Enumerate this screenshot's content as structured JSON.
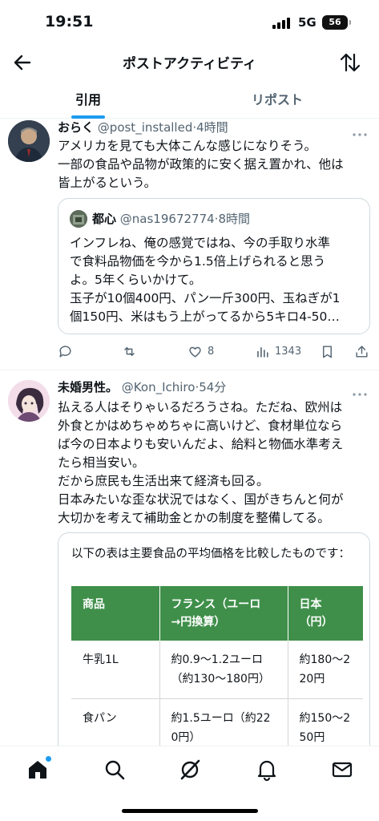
{
  "status_bar": {
    "time": "19:51",
    "network": "5G",
    "battery": "56"
  },
  "header": {
    "title": "ポストアクティビティ",
    "back_icon": "arrow-left-icon",
    "sort_icon": "sort-arrows-icon"
  },
  "tabs": [
    {
      "label": "引用",
      "active": true
    },
    {
      "label": "リポスト",
      "active": false
    }
  ],
  "post1": {
    "name": "おらく",
    "handle": "@post_installed",
    "time": "·4時間",
    "text": "アメリカを見ても大体こんな感じになりそう。\n一部の食品や品物が政策的に安く据え置かれ、他は\n皆上がるという。",
    "quote": {
      "name": "都心",
      "handle": "@nas19672774",
      "time": "·8時間",
      "text": "インフレね、俺の感覚ではね、今の手取り水準\nで食料品物価を今から1.5倍上げられると思う\nよ。5年くらいかけて。\n玉子が10個400円、パン一斤300円、玉ねぎが1\n個150円、米はもう上がってるから5キロ4-50…"
    },
    "actions": {
      "replies": "",
      "reposts": "",
      "likes": "8",
      "views": "1343"
    }
  },
  "post2": {
    "name": "未婚男性。",
    "handle": "@Kon_Ichiro",
    "time": "·54分",
    "text": "払える人はそりゃいるだろうさね。ただね、欧州は\n外食とかはめちゃめちゃに高いけど、食材単位なら\nば今の日本よりも安いんだよ、給料と物価水準考え\nたら相当安い。\nだから庶民も生活出来て経済も回る。\n日本みたいな歪な状況ではなく、国がきちんと何が\n大切かを考えて補助金とかの制度を整備してる。",
    "card": {
      "intro": "以下の表は主要食品の平均価格を比較したものです：",
      "headers": [
        "商品",
        "フランス（ユーロ\n→円換算）",
        "日本\n（円）"
      ],
      "rows": [
        [
          "牛乳1L",
          "約0.9〜1.2ユーロ\n（約130〜180円）",
          "約180〜2\n20円"
        ],
        [
          "食パン",
          "約1.5ユーロ（約22\n0円）",
          "約150〜2\n50円"
        ]
      ]
    }
  },
  "nav": [
    "home-icon",
    "search-icon",
    "grok-icon",
    "bell-icon",
    "mail-icon"
  ],
  "colors": {
    "accent": "#1d9bf0",
    "table_header": "#3f8f4a"
  }
}
